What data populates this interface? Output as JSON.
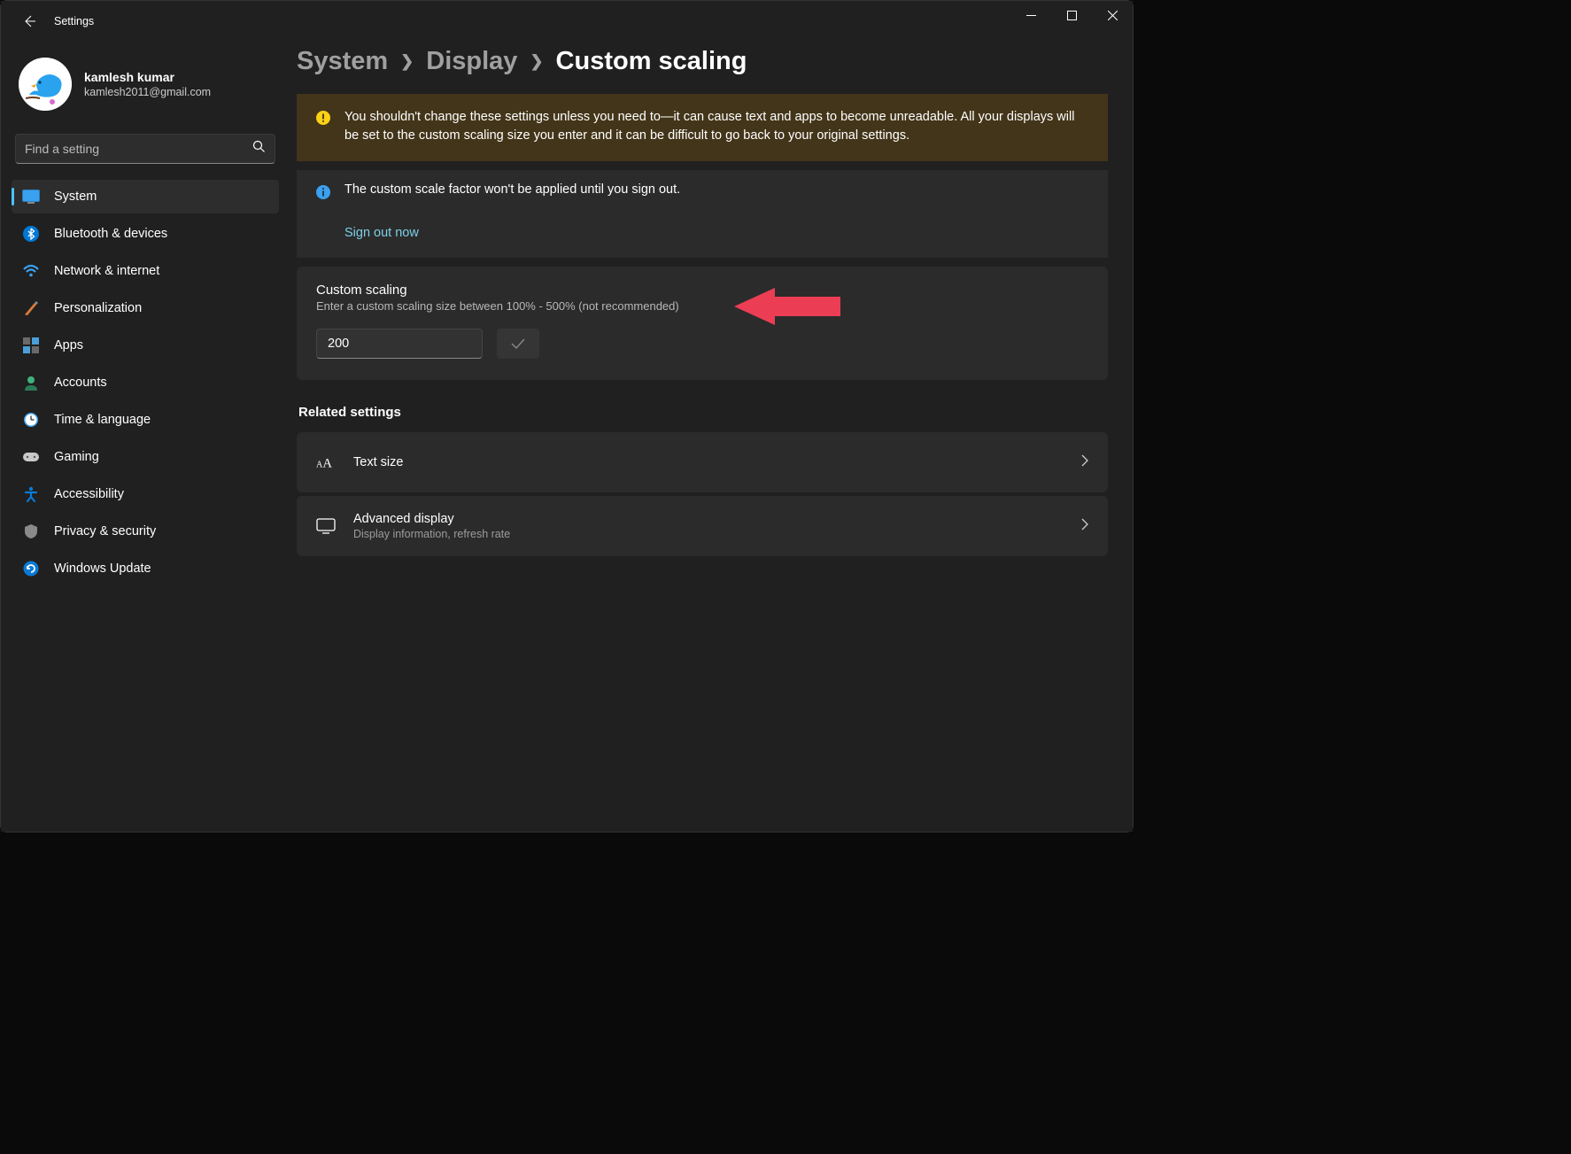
{
  "app": {
    "title": "Settings"
  },
  "user": {
    "name": "kamlesh kumar",
    "email": "kamlesh2011@gmail.com"
  },
  "search": {
    "placeholder": "Find a setting"
  },
  "nav": {
    "system": "System",
    "bluetooth": "Bluetooth & devices",
    "network": "Network & internet",
    "personalization": "Personalization",
    "apps": "Apps",
    "accounts": "Accounts",
    "time": "Time & language",
    "gaming": "Gaming",
    "accessibility": "Accessibility",
    "privacy": "Privacy & security",
    "update": "Windows Update"
  },
  "breadcrumb": {
    "l1": "System",
    "l2": "Display",
    "l3": "Custom scaling"
  },
  "warning": "You shouldn't change these settings unless you need to—it can cause text and apps to become unreadable. All your displays will be set to the custom scaling size you enter and it can be difficult to go back to your original settings.",
  "info": {
    "message": "The custom scale factor won't be applied until you sign out.",
    "action": "Sign out now"
  },
  "scaling": {
    "title": "Custom scaling",
    "subtitle": "Enter a custom scaling size between 100% - 500% (not recommended)",
    "value": "200"
  },
  "related": {
    "header": "Related settings",
    "textSize": {
      "title": "Text size"
    },
    "advanced": {
      "title": "Advanced display",
      "subtitle": "Display information, refresh rate"
    }
  },
  "colors": {
    "accent": "#4cc2ff",
    "link": "#7cd0e8",
    "warnBg": "#433519",
    "arrow": "#eb3e55"
  }
}
